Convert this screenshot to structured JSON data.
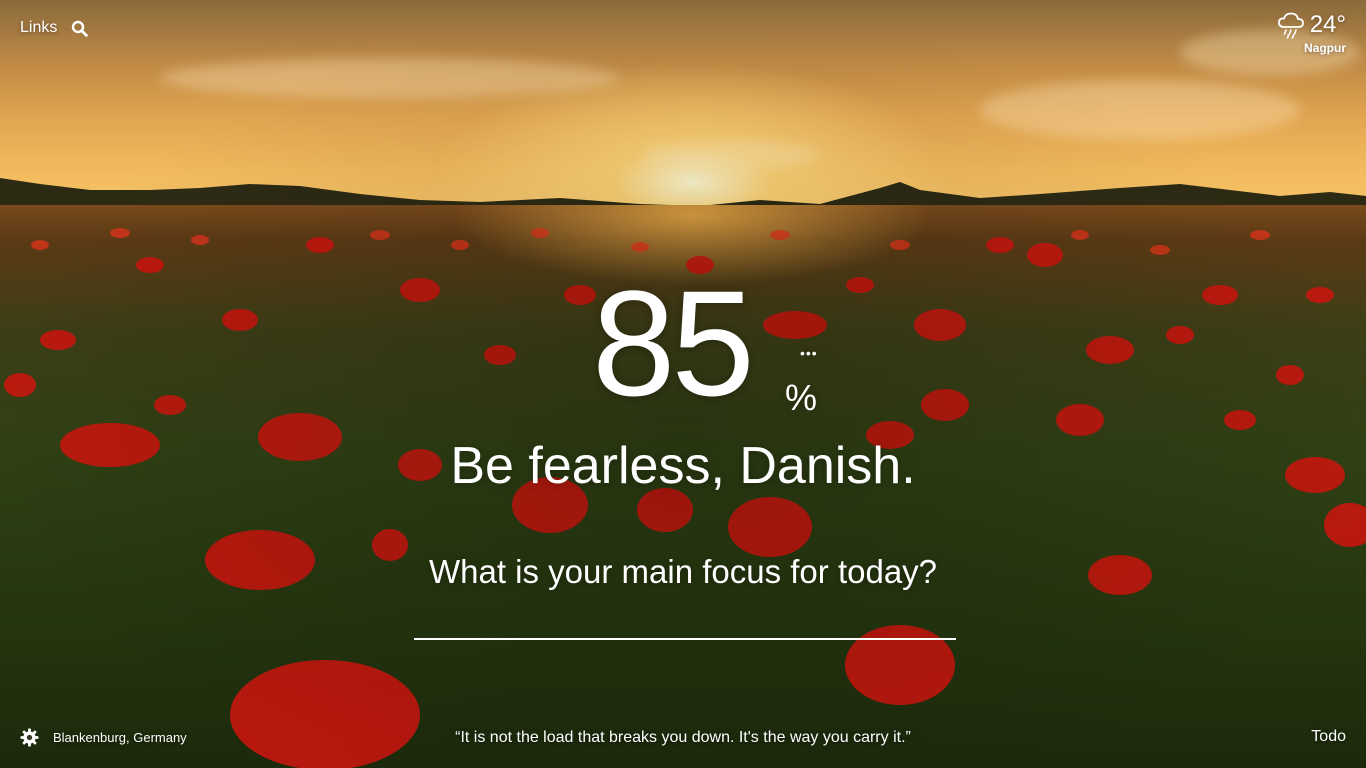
{
  "top_left": {
    "links_label": "Links",
    "search_icon": "search-icon"
  },
  "weather": {
    "icon": "rain-cloud-icon",
    "temperature": "24°",
    "city": "Nagpur"
  },
  "metric": {
    "value": "85",
    "unit": "%",
    "more_icon": "more-dots-icon"
  },
  "greeting": "Be fearless, Danish.",
  "focus": {
    "question": "What is your main focus for today?",
    "value": ""
  },
  "bottom": {
    "settings_icon": "gear-icon",
    "photo_location": "Blankenburg, Germany",
    "quote": "“It is not the load that breaks you down. It's the way you carry it.”",
    "todo_label": "Todo"
  }
}
